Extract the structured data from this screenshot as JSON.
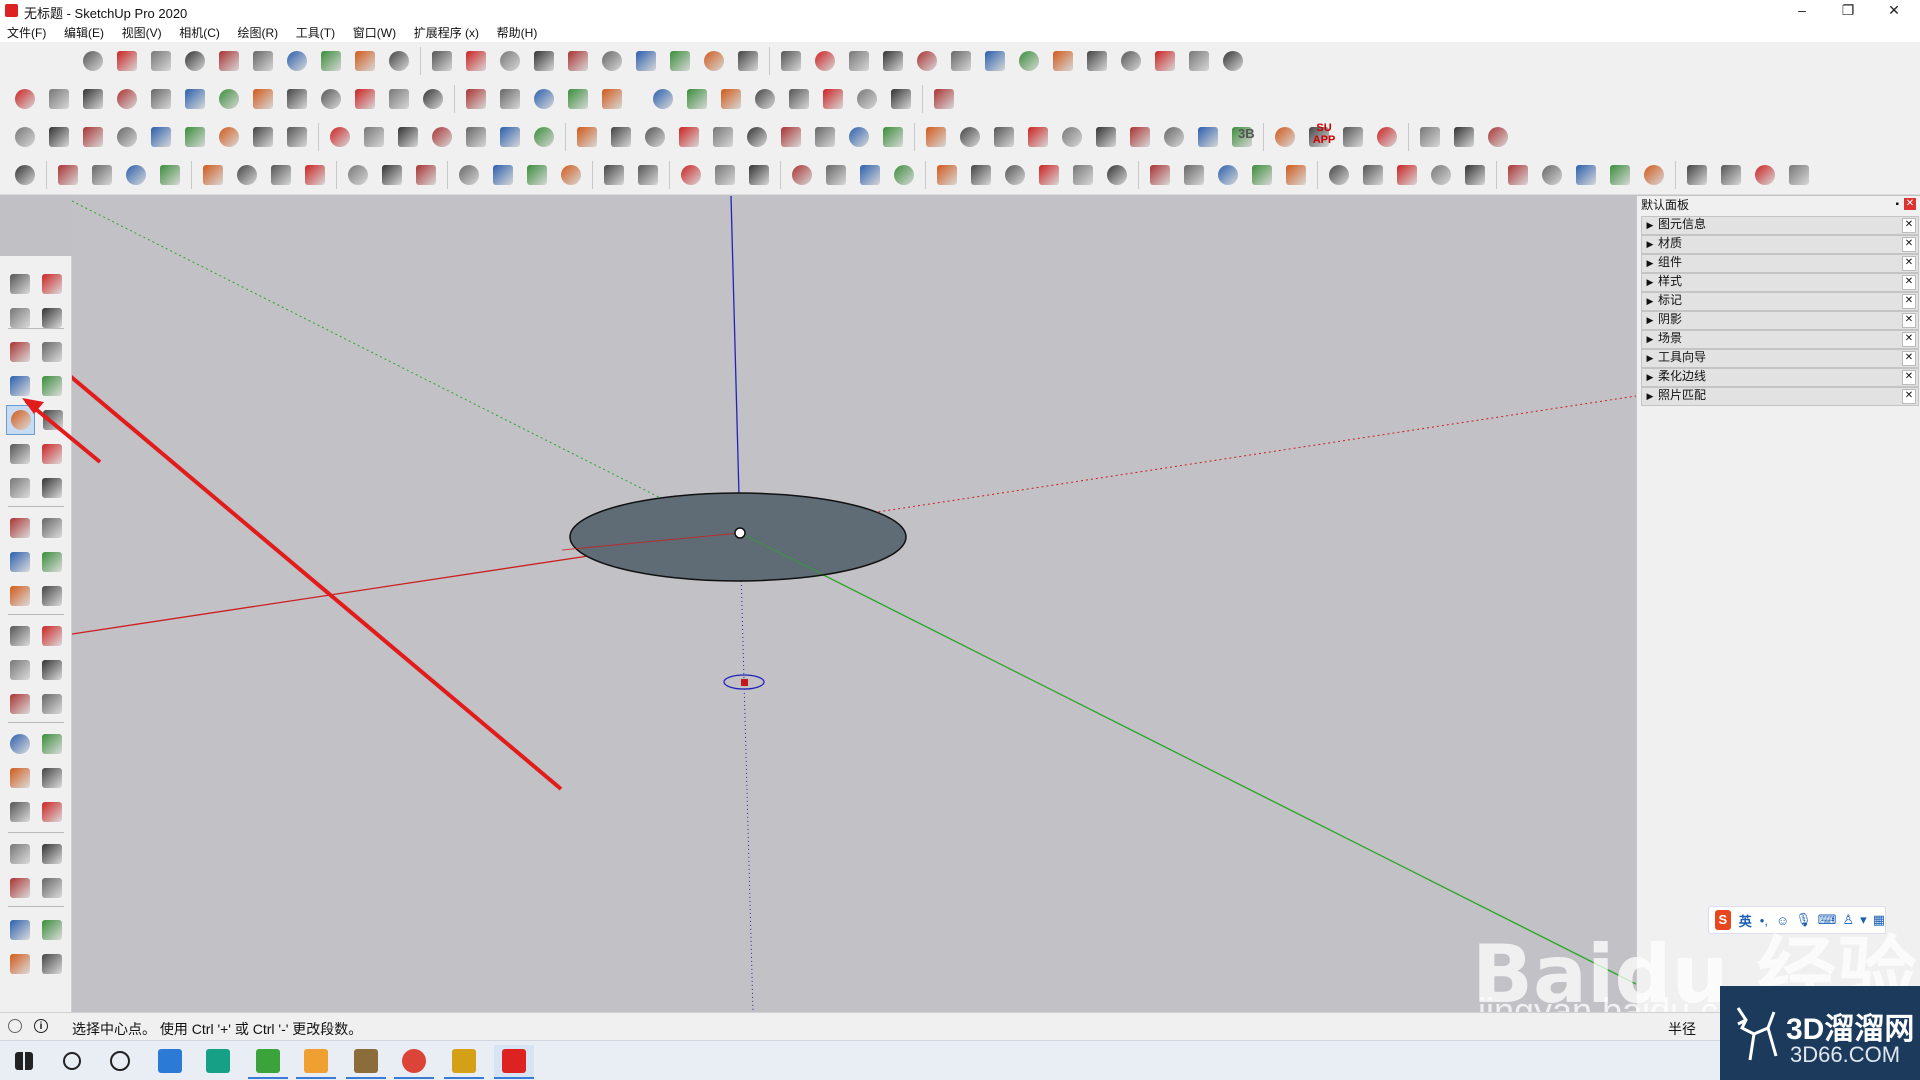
{
  "window": {
    "title": "无标题 - SketchUp Pro 2020",
    "controls": {
      "minimize": "–",
      "restore": "❐",
      "close": "✕"
    }
  },
  "menubar": {
    "items": [
      "文件(F)",
      "编辑(E)",
      "视图(V)",
      "相机(C)",
      "绘图(R)",
      "工具(T)",
      "窗口(W)",
      "扩展程序 (x)",
      "帮助(H)"
    ]
  },
  "toolbars": {
    "row1_icon": "extension-tool-icon",
    "row2_icon": "curve-draw-icon",
    "row3_icon": "view-tool-icon",
    "row4_icon": "main-tool-icon",
    "labels": {
      "b3": "3B",
      "su_app": "SU APP"
    }
  },
  "left_toolbar": {
    "tools": [
      [
        "select-icon",
        "component-icon"
      ],
      [
        "paint-bucket-icon",
        "eraser-icon"
      ],
      [
        "pencil-icon",
        "freehand-icon"
      ],
      [
        "rectangle-icon",
        "rotated-rectangle-icon"
      ],
      [
        "circle-icon",
        "polygon-icon"
      ],
      [
        "arc-icon",
        "two-point-arc-icon"
      ],
      [
        "three-point-arc-icon",
        "pie-icon"
      ],
      [
        "move-icon",
        "push-pull-icon"
      ],
      [
        "rotate-icon",
        "follow-me-icon"
      ],
      [
        "scale-icon",
        "offset-icon"
      ],
      [
        "tape-measure-icon",
        "dimension-icon"
      ],
      [
        "protractor-icon",
        "text-icon"
      ],
      [
        "axes-icon",
        "3d-text-icon"
      ],
      [
        "orbit-icon",
        "pan-icon"
      ],
      [
        "zoom-icon",
        "zoom-window-icon"
      ],
      [
        "zoom-extents-icon",
        "previous-view-icon"
      ],
      [
        "position-camera-icon",
        "look-around-icon"
      ],
      [
        "walk-icon",
        "section-plane-icon"
      ],
      [
        "warehouse-icon",
        "extension-warehouse-icon"
      ],
      [
        "share-model-icon",
        "ruby-icon"
      ]
    ]
  },
  "tray": {
    "title": "默认面板",
    "items": [
      "图元信息",
      "材质",
      "组件",
      "样式",
      "标记",
      "阴影",
      "场景",
      "工具向导",
      "柔化边线",
      "照片匹配"
    ]
  },
  "status": {
    "text": "选择中心点。 使用 Ctrl '+' 或 Ctrl '-' 更改段数。",
    "measure_label": "半径"
  },
  "ime": {
    "logo": "S",
    "mode": "英"
  },
  "watermarks": {
    "baidu": "Baidu 经验",
    "jingyan": "jingyan.baidu.com",
    "site_cn": "3D溜溜网",
    "site_en": "3D66.COM"
  },
  "colors": {
    "axis_red": "#cc1f1f",
    "axis_green": "#2aa52a",
    "axis_blue": "#2323b8",
    "circle_fill": "#5f6b75",
    "annotation_arrow": "#e21b1b",
    "viewport_bg": "#c1c1c6"
  }
}
